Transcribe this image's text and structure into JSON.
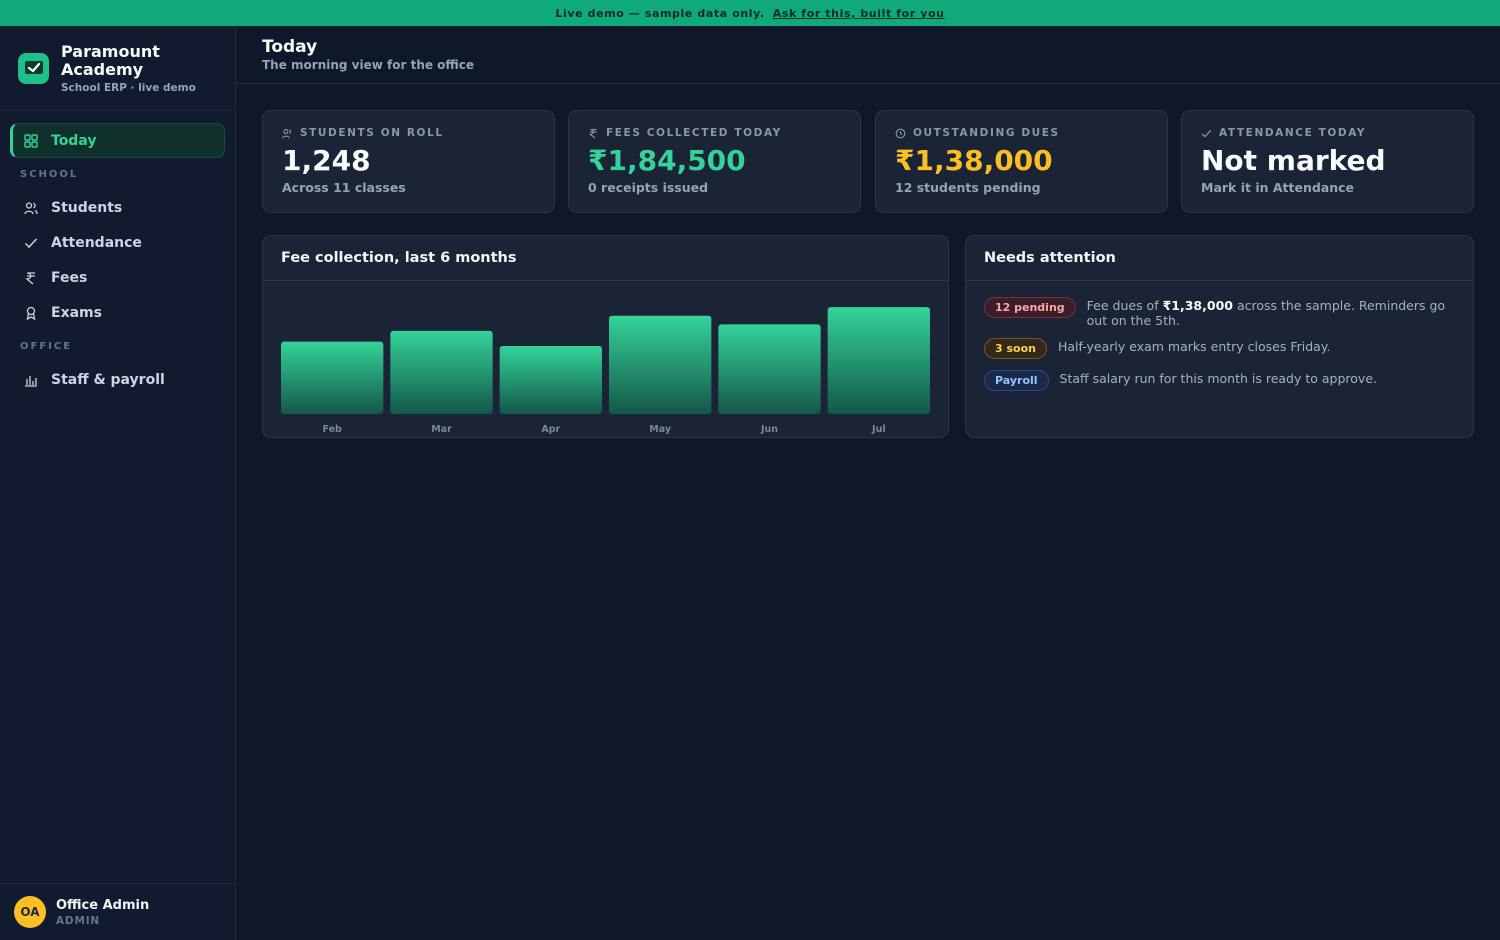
{
  "banner": {
    "text": "Live demo — sample data only.",
    "link": "Ask for this, built for you"
  },
  "brand": {
    "name_line1": "Paramount",
    "name_line2": "Academy",
    "sub": "School ERP · live demo"
  },
  "nav": {
    "today": "Today",
    "section_school": "SCHOOL",
    "students": "Students",
    "attendance": "Attendance",
    "fees": "Fees",
    "exams": "Exams",
    "section_office": "OFFICE",
    "staff": "Staff & payroll"
  },
  "user": {
    "initials": "OA",
    "name": "Office Admin",
    "role": "ADMIN"
  },
  "header": {
    "title": "Today",
    "subtitle": "The morning view for the office"
  },
  "stats": [
    {
      "label": "STUDENTS ON ROLL",
      "value": "1,248",
      "note": "Across 11 classes"
    },
    {
      "label": "FEES COLLECTED TODAY",
      "value": "₹1,84,500",
      "note": "0 receipts issued"
    },
    {
      "label": "OUTSTANDING DUES",
      "value": "₹1,38,000",
      "note": "12 students pending"
    },
    {
      "label": "ATTENDANCE TODAY",
      "value": "Not marked",
      "note": "Mark it in Attendance"
    }
  ],
  "fee_panel": {
    "title": "Fee collection, last 6 months"
  },
  "chart_data": {
    "type": "bar",
    "title": "Fee collection, last 6 months",
    "categories": [
      "Feb",
      "Mar",
      "Apr",
      "May",
      "Jun",
      "Jul"
    ],
    "values": [
      67,
      77,
      63,
      91,
      83,
      99
    ],
    "ylim": [
      0,
      100
    ],
    "grid": false,
    "legend": "none",
    "colors": {
      "bar_top": "#34d399",
      "bar_bottom": "#14574a"
    }
  },
  "attention": {
    "title": "Needs attention",
    "items": [
      {
        "badge": "12 pending",
        "pre": "Fee dues of ",
        "bold": "₹1,38,000",
        "post": " across the sample. Reminders go out on the 5th."
      },
      {
        "badge": "3 soon",
        "text": "Half-yearly exam marks entry closes Friday."
      },
      {
        "badge": "Payroll",
        "text": "Staff salary run for this month is ready to approve."
      }
    ]
  },
  "colors": {
    "accent": "#34d399",
    "amber": "#fbbf24",
    "background": "#0f172a",
    "banner": "#10a97a"
  }
}
